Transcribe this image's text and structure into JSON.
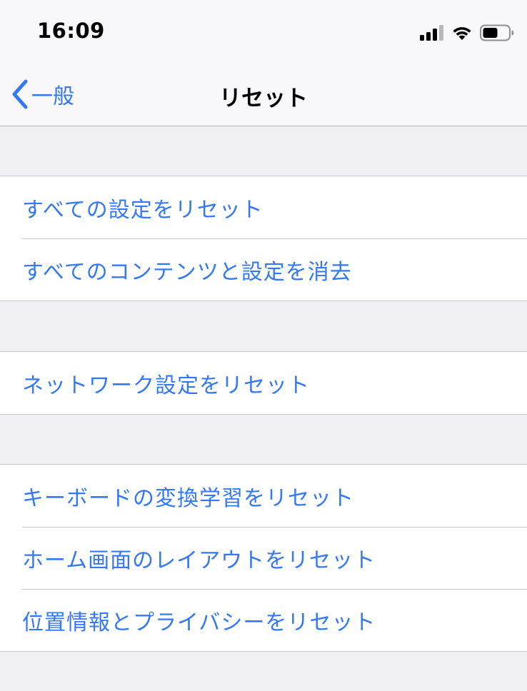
{
  "status_bar": {
    "time": "16:09"
  },
  "nav": {
    "back_label": "一般",
    "title": "リセット"
  },
  "groups": [
    {
      "items": [
        {
          "label": "すべての設定をリセット"
        },
        {
          "label": "すべてのコンテンツと設定を消去"
        }
      ]
    },
    {
      "items": [
        {
          "label": "ネットワーク設定をリセット"
        }
      ]
    },
    {
      "items": [
        {
          "label": "キーボードの変換学習をリセット"
        },
        {
          "label": "ホーム画面のレイアウトをリセット"
        },
        {
          "label": "位置情報とプライバシーをリセット"
        }
      ]
    }
  ],
  "colors": {
    "accent": "#3478f6",
    "background": "#efeff4",
    "cell": "#ffffff",
    "separator": "#c8c7cc"
  },
  "icons": [
    "chevron-left-icon",
    "cellular-signal-icon",
    "wifi-icon",
    "battery-icon"
  ]
}
